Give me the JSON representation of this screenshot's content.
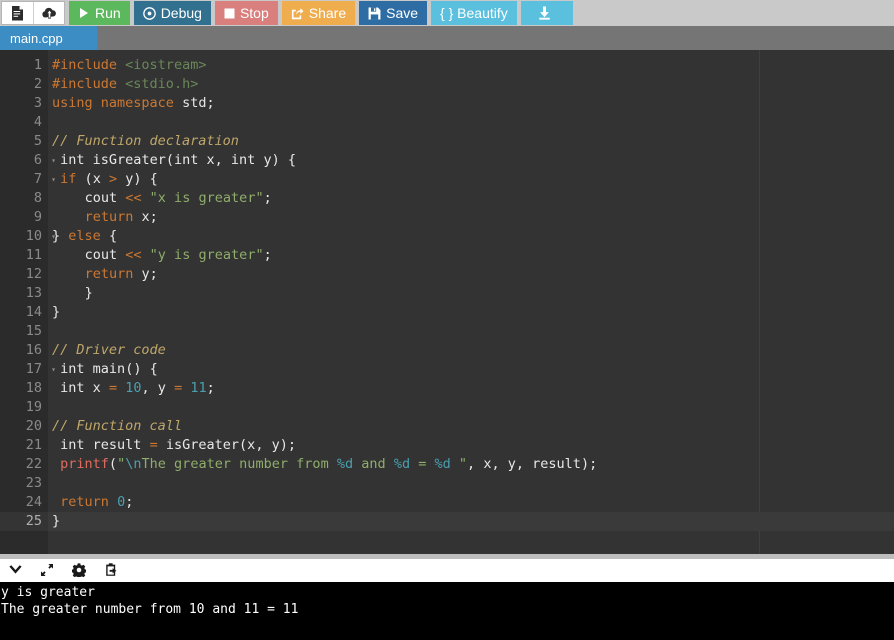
{
  "toolbar": {
    "icons": [
      {
        "name": "new-file-icon",
        "label": "New File"
      },
      {
        "name": "upload-icon",
        "label": "Upload"
      }
    ],
    "buttons": [
      {
        "name": "run-button",
        "label": "Run",
        "icon": "play-icon",
        "color": "#5cb85c"
      },
      {
        "name": "debug-button",
        "label": "Debug",
        "icon": "debug-icon",
        "color": "#31708f"
      },
      {
        "name": "stop-button",
        "label": "Stop",
        "icon": "stop-icon",
        "color": "#d9807e"
      },
      {
        "name": "share-button",
        "label": "Share",
        "icon": "share-icon",
        "color": "#f0ad4e"
      },
      {
        "name": "save-button",
        "label": "Save",
        "icon": "floppy-icon",
        "color": "#2e6da4"
      },
      {
        "name": "beautify-button",
        "label": "{ } Beautify",
        "icon": "braces-icon",
        "color": "#5bc0de"
      },
      {
        "name": "download-button",
        "label": "",
        "icon": "download-icon",
        "color": "#5bc0de"
      }
    ]
  },
  "tabs": [
    {
      "name": "tab-main-cpp",
      "label": "main.cpp",
      "active": true
    }
  ],
  "editor": {
    "language": "cpp",
    "active_line": 25,
    "total_lines": 25,
    "fold_lines": [
      6,
      7,
      10,
      17
    ],
    "lines": [
      {
        "n": 1,
        "text": "#include <iostream>"
      },
      {
        "n": 2,
        "text": "#include <stdio.h>"
      },
      {
        "n": 3,
        "text": "using namespace std;"
      },
      {
        "n": 4,
        "text": ""
      },
      {
        "n": 5,
        "text": "// Function declaration"
      },
      {
        "n": 6,
        "text": " int isGreater(int x, int y) {"
      },
      {
        "n": 7,
        "text": " if (x > y) {"
      },
      {
        "n": 8,
        "text": "    cout << \"x is greater\";"
      },
      {
        "n": 9,
        "text": "    return x;"
      },
      {
        "n": 10,
        "text": "} else {"
      },
      {
        "n": 11,
        "text": "    cout << \"y is greater\";"
      },
      {
        "n": 12,
        "text": "    return y;"
      },
      {
        "n": 13,
        "text": "    }"
      },
      {
        "n": 14,
        "text": "}"
      },
      {
        "n": 15,
        "text": ""
      },
      {
        "n": 16,
        "text": "// Driver code"
      },
      {
        "n": 17,
        "text": " int main() {"
      },
      {
        "n": 18,
        "text": " int x = 10, y = 11;"
      },
      {
        "n": 19,
        "text": ""
      },
      {
        "n": 20,
        "text": "// Function call"
      },
      {
        "n": 21,
        "text": " int result = isGreater(x, y);"
      },
      {
        "n": 22,
        "text": " printf(\"\\nThe greater number from %d and %d = %d \", x, y, result);"
      },
      {
        "n": 23,
        "text": ""
      },
      {
        "n": 24,
        "text": " return 0;"
      },
      {
        "n": 25,
        "text": "}"
      }
    ]
  },
  "console_bar": {
    "icons": [
      {
        "name": "chevron-down-icon",
        "label": "Collapse"
      },
      {
        "name": "expand-arrows-icon",
        "label": "Maximize"
      },
      {
        "name": "gear-icon",
        "label": "Settings"
      },
      {
        "name": "paste-icon",
        "label": "Paste Input"
      }
    ]
  },
  "console": {
    "output_lines": [
      "y is greater",
      "The greater number from 10 and 11 = 11"
    ]
  },
  "colors": {
    "toolbar_bg": "#c9c9c9",
    "tabbar_bg": "#757575",
    "tab_active_bg": "#3b8dc4",
    "editor_bg": "#333333",
    "gutter_bg": "#2b2b2b",
    "console_bg": "#000000",
    "console_fg": "#ffffff"
  }
}
